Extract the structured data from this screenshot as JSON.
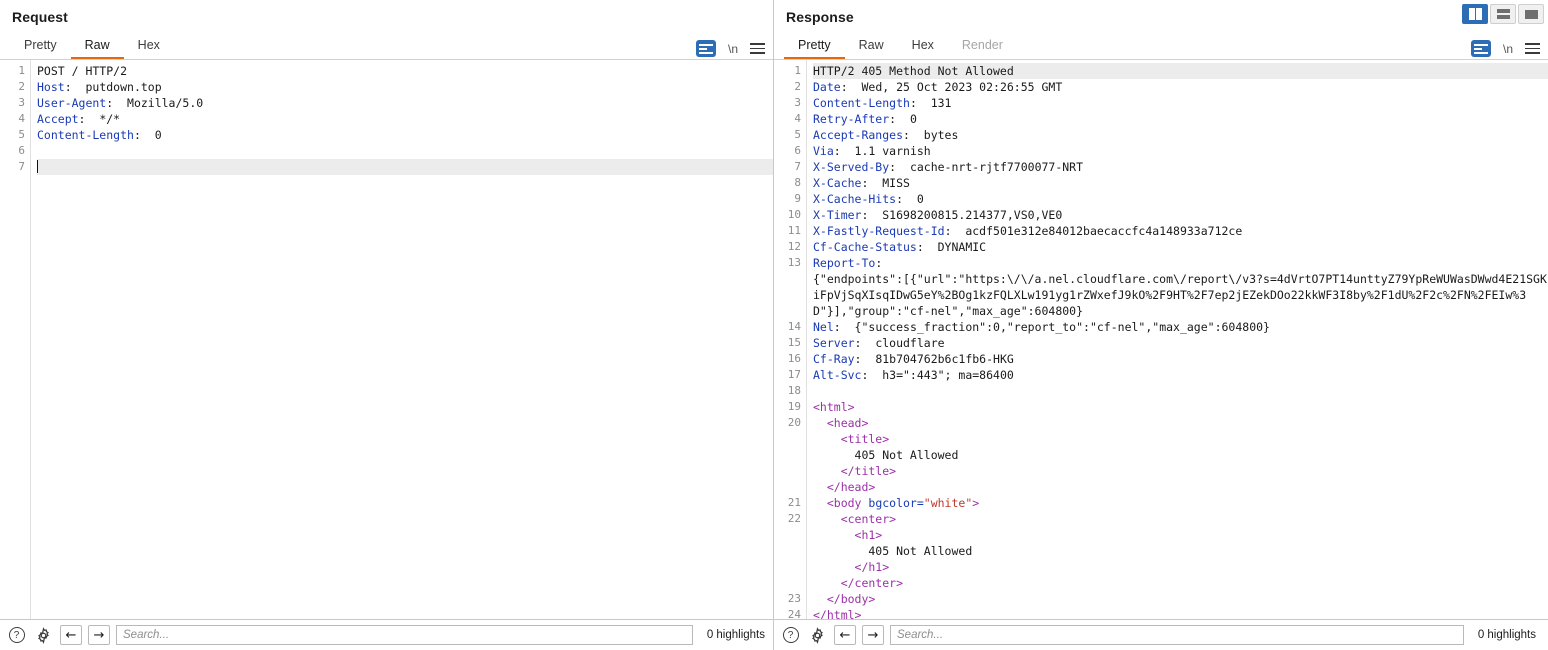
{
  "layout_buttons": [
    {
      "name": "side-by-side",
      "active": true
    },
    {
      "name": "stacked",
      "active": false
    },
    {
      "name": "single",
      "active": false
    }
  ],
  "request": {
    "title": "Request",
    "tabs": [
      {
        "label": "Pretty",
        "active": false,
        "disabled": false
      },
      {
        "label": "Raw",
        "active": true,
        "disabled": false
      },
      {
        "label": "Hex",
        "active": false,
        "disabled": false
      }
    ],
    "tools": {
      "wrap_label": "word-wrap",
      "newline_label": "\\n",
      "menu_label": "menu"
    },
    "lines": [
      {
        "n": "1",
        "tokens": [
          {
            "t": "plain",
            "s": "POST / HTTP/2"
          }
        ]
      },
      {
        "n": "2",
        "tokens": [
          {
            "t": "hdrname",
            "s": "Host"
          },
          {
            "t": "plain",
            "s": ":  putdown.top"
          }
        ]
      },
      {
        "n": "3",
        "tokens": [
          {
            "t": "hdrname",
            "s": "User-Agent"
          },
          {
            "t": "plain",
            "s": ":  Mozilla/5.0"
          }
        ]
      },
      {
        "n": "4",
        "tokens": [
          {
            "t": "hdrname",
            "s": "Accept"
          },
          {
            "t": "plain",
            "s": ":  */*"
          }
        ]
      },
      {
        "n": "5",
        "tokens": [
          {
            "t": "hdrname",
            "s": "Content-Length"
          },
          {
            "t": "plain",
            "s": ":  0"
          }
        ]
      },
      {
        "n": "6",
        "tokens": []
      },
      {
        "n": "7",
        "tokens": [],
        "highlight": true,
        "caret": true
      }
    ],
    "bottom": {
      "help_label": "?",
      "settings_label": "settings",
      "back_label": "←",
      "forward_label": "→",
      "search_placeholder": "Search...",
      "search_value": "",
      "highlights_text": "0 highlights"
    }
  },
  "response": {
    "title": "Response",
    "tabs": [
      {
        "label": "Pretty",
        "active": true,
        "disabled": false
      },
      {
        "label": "Raw",
        "active": false,
        "disabled": false
      },
      {
        "label": "Hex",
        "active": false,
        "disabled": false
      },
      {
        "label": "Render",
        "active": false,
        "disabled": true
      }
    ],
    "tools": {
      "wrap_label": "word-wrap",
      "newline_label": "\\n",
      "menu_label": "menu"
    },
    "lines": [
      {
        "n": "1",
        "highlight": true,
        "tokens": [
          {
            "t": "plain",
            "s": "HTTP/2 405 Method Not Allowed"
          }
        ]
      },
      {
        "n": "2",
        "tokens": [
          {
            "t": "hdrname",
            "s": "Date"
          },
          {
            "t": "plain",
            "s": ":  Wed, 25 Oct 2023 02:26:55 GMT"
          }
        ]
      },
      {
        "n": "3",
        "tokens": [
          {
            "t": "hdrname",
            "s": "Content-Length"
          },
          {
            "t": "plain",
            "s": ":  131"
          }
        ]
      },
      {
        "n": "4",
        "tokens": [
          {
            "t": "hdrname",
            "s": "Retry-After"
          },
          {
            "t": "plain",
            "s": ":  0"
          }
        ]
      },
      {
        "n": "5",
        "tokens": [
          {
            "t": "hdrname",
            "s": "Accept-Ranges"
          },
          {
            "t": "plain",
            "s": ":  bytes"
          }
        ]
      },
      {
        "n": "6",
        "tokens": [
          {
            "t": "hdrname",
            "s": "Via"
          },
          {
            "t": "plain",
            "s": ":  1.1 varnish"
          }
        ]
      },
      {
        "n": "7",
        "tokens": [
          {
            "t": "hdrname",
            "s": "X-Served-By"
          },
          {
            "t": "plain",
            "s": ":  cache-nrt-rjtf7700077-NRT"
          }
        ]
      },
      {
        "n": "8",
        "tokens": [
          {
            "t": "hdrname",
            "s": "X-Cache"
          },
          {
            "t": "plain",
            "s": ":  MISS"
          }
        ]
      },
      {
        "n": "9",
        "tokens": [
          {
            "t": "hdrname",
            "s": "X-Cache-Hits"
          },
          {
            "t": "plain",
            "s": ":  0"
          }
        ]
      },
      {
        "n": "10",
        "tokens": [
          {
            "t": "hdrname",
            "s": "X-Timer"
          },
          {
            "t": "plain",
            "s": ":  S1698200815.214377,VS0,VE0"
          }
        ]
      },
      {
        "n": "11",
        "tokens": [
          {
            "t": "hdrname",
            "s": "X-Fastly-Request-Id"
          },
          {
            "t": "plain",
            "s": ":  acdf501e312e84012baecaccfc4a148933a712ce"
          }
        ]
      },
      {
        "n": "12",
        "tokens": [
          {
            "t": "hdrname",
            "s": "Cf-Cache-Status"
          },
          {
            "t": "plain",
            "s": ":  DYNAMIC"
          }
        ]
      },
      {
        "n": "13",
        "tokens": [
          {
            "t": "hdrname",
            "s": "Report-To"
          },
          {
            "t": "plain",
            "s": ":"
          }
        ]
      },
      {
        "n": "",
        "wrap": true,
        "tokens": [
          {
            "t": "plain",
            "s": "{\"endpoints\":[{\"url\":\"https:\\/\\/a.nel.cloudflare.com\\/report\\/v3?s=4dVrtO7PT14unttyZ79YpReWUWasDWwd4E21SGKiFpVjSqXIsqIDwG5eY%2BOg1kzFQLXLw191yg1rZWxefJ9kO%2F9HT%2F7ep2jEZekDOo22kkWF3I8by%2F1dU%2F2c%2FN%2FEIw%3D\"}],\"group\":\"cf-nel\",\"max_age\":604800}"
          }
        ]
      },
      {
        "n": "14",
        "tokens": [
          {
            "t": "hdrname",
            "s": "Nel"
          },
          {
            "t": "plain",
            "s": ":  {\"success_fraction\":0,\"report_to\":\"cf-nel\",\"max_age\":604800}"
          }
        ]
      },
      {
        "n": "15",
        "tokens": [
          {
            "t": "hdrname",
            "s": "Server"
          },
          {
            "t": "plain",
            "s": ":  cloudflare"
          }
        ]
      },
      {
        "n": "16",
        "tokens": [
          {
            "t": "hdrname",
            "s": "Cf-Ray"
          },
          {
            "t": "plain",
            "s": ":  81b704762b6c1fb6-HKG"
          }
        ]
      },
      {
        "n": "17",
        "tokens": [
          {
            "t": "hdrname",
            "s": "Alt-Svc"
          },
          {
            "t": "plain",
            "s": ":  h3=\":443\"; ma=86400"
          }
        ]
      },
      {
        "n": "18",
        "tokens": []
      },
      {
        "n": "19",
        "tokens": [
          {
            "t": "tag",
            "s": "<html>"
          }
        ]
      },
      {
        "n": "20",
        "tokens": [
          {
            "t": "tag",
            "s": "  <head>"
          }
        ]
      },
      {
        "n": "",
        "tokens": [
          {
            "t": "tag",
            "s": "    <title>"
          }
        ]
      },
      {
        "n": "",
        "tokens": [
          {
            "t": "plain",
            "s": "      405 Not Allowed"
          }
        ]
      },
      {
        "n": "",
        "tokens": [
          {
            "t": "tag",
            "s": "    </title>"
          }
        ]
      },
      {
        "n": "",
        "tokens": [
          {
            "t": "tag",
            "s": "  </head>"
          }
        ]
      },
      {
        "n": "21",
        "tokens": [
          {
            "t": "tag",
            "s": "  <body "
          },
          {
            "t": "attr",
            "s": "bgcolor="
          },
          {
            "t": "val",
            "s": "\"white\""
          },
          {
            "t": "tag",
            "s": ">"
          }
        ]
      },
      {
        "n": "22",
        "tokens": [
          {
            "t": "tag",
            "s": "    <center>"
          }
        ]
      },
      {
        "n": "",
        "tokens": [
          {
            "t": "tag",
            "s": "      <h1>"
          }
        ]
      },
      {
        "n": "",
        "tokens": [
          {
            "t": "plain",
            "s": "        405 Not Allowed"
          }
        ]
      },
      {
        "n": "",
        "tokens": [
          {
            "t": "tag",
            "s": "      </h1>"
          }
        ]
      },
      {
        "n": "",
        "tokens": [
          {
            "t": "tag",
            "s": "    </center>"
          }
        ]
      },
      {
        "n": "23",
        "tokens": [
          {
            "t": "tag",
            "s": "  </body>"
          }
        ]
      },
      {
        "n": "24",
        "tokens": [
          {
            "t": "tag",
            "s": "</html>"
          }
        ]
      }
    ],
    "bottom": {
      "help_label": "?",
      "settings_label": "settings",
      "back_label": "←",
      "forward_label": "→",
      "search_placeholder": "Search...",
      "search_value": "",
      "highlights_text": "0 highlights"
    }
  },
  "colors": {
    "accent_orange": "#e8670c",
    "accent_blue": "#2d6db5",
    "header_name": "#1a3ab5",
    "tag_purple": "#9b30a8",
    "attr_value_red": "#c0392b"
  }
}
